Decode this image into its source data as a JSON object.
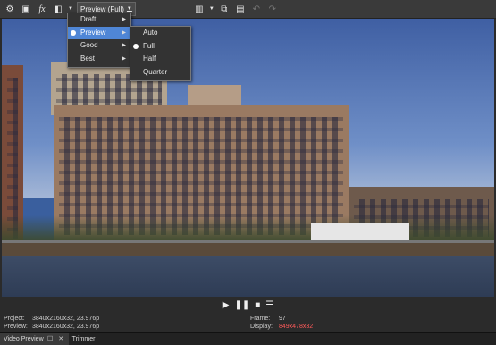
{
  "toolbar": {
    "icons": [
      "preview-settings-icon",
      "external-monitor-icon",
      "fx-icon",
      "split-screen-icon",
      "dropdown-icon",
      "overlays-icon",
      "copy-snapshot-icon",
      "save-snapshot-icon",
      "undo-icon",
      "redo-icon"
    ],
    "fx_label": "fx",
    "quality_label": "Preview (Full)"
  },
  "quality_menu": {
    "items": [
      {
        "label": "Draft",
        "has_submenu": true
      },
      {
        "label": "Preview",
        "has_submenu": true,
        "selected": true,
        "highlighted": true
      },
      {
        "label": "Good",
        "has_submenu": true
      },
      {
        "label": "Best",
        "has_submenu": true
      }
    ]
  },
  "size_menu": {
    "items": [
      {
        "label": "Auto"
      },
      {
        "label": "Full",
        "selected": true
      },
      {
        "label": "Half"
      },
      {
        "label": "Quarter"
      }
    ]
  },
  "transport": {
    "icons": [
      "play-icon",
      "pause-icon",
      "stop-icon",
      "menu-icon"
    ]
  },
  "info": {
    "project_label": "Project:",
    "project_value": "3840x2160x32, 23.976p",
    "preview_label": "Preview:",
    "preview_value": "3840x2160x32, 23.976p",
    "frame_label": "Frame:",
    "frame_value": "97",
    "display_label": "Display:",
    "display_value": "849x478x32",
    "display_color": "#ff5a5a"
  },
  "tabs": [
    {
      "label": "Video Preview",
      "active": true
    },
    {
      "label": "Trimmer",
      "active": false
    }
  ]
}
